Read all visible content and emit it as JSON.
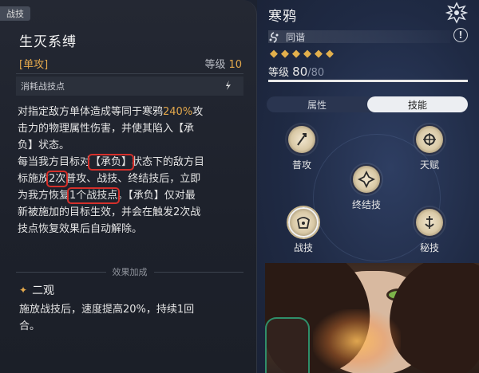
{
  "skill_panel": {
    "tag": "战技",
    "skill_name": "生灭系缚",
    "skill_type": "[单攻]",
    "level_label": "等级",
    "level_value": "10",
    "cost_label": "消耗战技点",
    "desc": {
      "l1a": "对指定敌方单体造成等同于寒鸦",
      "l1b": "240%",
      "l1c": "攻",
      "l2": "击力的物理属性伤害，并使其陷入【承",
      "l3": "负】状态。",
      "l4a": "每当我方目标对",
      "l4b": "【承负】",
      "l4c": "状态下的敌方目",
      "l5a": "标施放",
      "l5b": "2次",
      "l5c": "普攻、战技、终结技后，立即",
      "l6a": "为我方恢复",
      "l6b": "1个战技点",
      "l6c": "。【承负】仅对最",
      "l7": "新被施加的目标生效，并会在触发2次战",
      "l8": "技点恢复效果后自动解除。"
    },
    "effect_title": "效果加成",
    "trace_name": "二观",
    "trace_desc_1": "施放战技后，速度提高20%，持续1回",
    "trace_desc_2": "合。"
  },
  "char_panel": {
    "name": "寒鸦",
    "path": "同谐",
    "stars": 6,
    "level_label": "等级",
    "level_current": "80",
    "level_max": "/80",
    "level_fraction": 1.0,
    "tabs": [
      "属性",
      "技能"
    ],
    "active_tab": 1,
    "skills": {
      "basic": "普攻",
      "talent": "天赋",
      "ultimate": "终结技",
      "skill": "战技",
      "technique": "秘技"
    }
  },
  "colors": {
    "accent": "#e3a84c",
    "highlight_box": "#d4302b",
    "active_tab_bg": "#eceef2"
  }
}
